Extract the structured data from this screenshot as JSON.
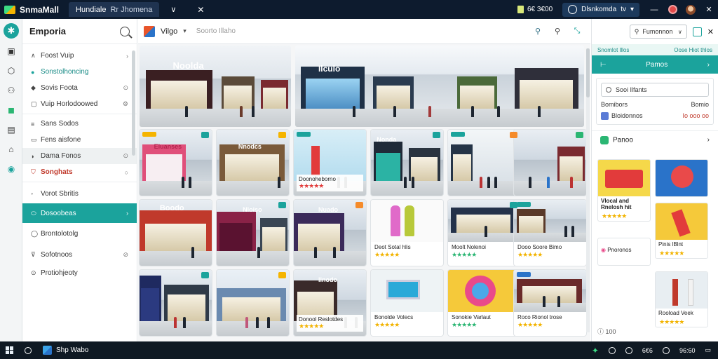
{
  "titlebar": {
    "app_name": "SnmaMall",
    "tab_title": "Hundiale",
    "tab_subtitle": "Rr Jhomena",
    "balance": "6€ 3€00",
    "account_label": "Dlsnkomda",
    "account_chev": "tv"
  },
  "sidebar": {
    "title": "Emporia",
    "items": [
      {
        "label": "Foost Vuip",
        "trail": "›"
      },
      {
        "label": "Sonstolhoncing",
        "trail": ""
      },
      {
        "label": "Sovis Foota",
        "trail": "⊙"
      },
      {
        "label": "Vuip Horlodoowed",
        "trail": "⚙"
      },
      {
        "label": "Sans Sodos",
        "trail": ""
      },
      {
        "label": "Fens aisfone",
        "trail": ""
      },
      {
        "label": "Dama Fonos",
        "trail": "⊙"
      },
      {
        "label": "Songhats",
        "trail": "○"
      },
      {
        "label": "Vorot Sbritis",
        "trail": ""
      },
      {
        "label": "Dosoobeas",
        "trail": "›"
      },
      {
        "label": "Brontolotolg",
        "trail": ""
      },
      {
        "label": "Sofotnoos",
        "trail": "⊘"
      },
      {
        "label": "Protiohjeoty",
        "trail": ""
      }
    ]
  },
  "main": {
    "label": "Vilgo",
    "breadcrumb": "Soorto Illaho",
    "hero": [
      {
        "sign": "Noolda"
      },
      {
        "sign": "Ilculo"
      }
    ],
    "row1": [
      {
        "sign": "Eluanses"
      },
      {
        "sign": "Nnodcs"
      },
      {
        "sign": "",
        "caption": "Doonoheborno",
        "stars": "★★★★★"
      },
      {
        "sign": "Nonda"
      },
      {
        "sign": ""
      },
      {
        "sign": ""
      }
    ],
    "row2": [
      {
        "sign": "Boodo"
      },
      {
        "sign": "Nloiso"
      },
      {
        "sign": "Nuado"
      },
      {
        "caption": "Deot Sotal hlis",
        "stars": "★★★★★"
      },
      {
        "caption": "Moolt Nolenoi",
        "stars": "★★★★★"
      },
      {
        "caption": "Dooo Soore Bimo",
        "stars": "★★★★★"
      }
    ],
    "row3": [
      {
        "sign": ""
      },
      {
        "sign": ""
      },
      {
        "sign": "Ilnodo",
        "caption": "Donool Reslotdes",
        "stars": "★★★★★"
      },
      {
        "caption": "Bonolde Volecs",
        "stars": "★★★★★"
      },
      {
        "caption": "Sonokie Varlaut",
        "stars": "★★★★★"
      },
      {
        "caption": "Roco Rionol trose",
        "stars": "★★★★★"
      }
    ]
  },
  "rpanel": {
    "select_label": "Fumonnon",
    "banner_left": "Snomlot lllos",
    "banner_right": "Oose Hiot thlos",
    "bar_label": "Pamos",
    "input_value": "Sooi Ilfants",
    "row1_left": "Bomibors",
    "row1_right": "Bomio",
    "row2_left": "Bloidonnos",
    "row2_right": "Io ooo oo",
    "section_label": "Panoo",
    "tiles": [
      {
        "caption": "Vlocal and Rnelosh hit",
        "stars": "★★★★★"
      },
      {
        "caption": ""
      },
      {
        "caption": "Pnoronos",
        "stars": ""
      },
      {
        "caption": "Pinis lBlnt",
        "stars": "★★★★★"
      },
      {
        "caption": ""
      },
      {
        "caption": "Rooload Veek",
        "stars": "★★★★★"
      }
    ],
    "foot": "100"
  },
  "taskbar": {
    "app_label": "Shp Wabo",
    "time": "6€6",
    "date": "96:60"
  },
  "colors": {
    "accent": "#1ba39c",
    "titlebar": "#0d1b2e",
    "star": "#f2b300",
    "alert": "#c0392b"
  }
}
